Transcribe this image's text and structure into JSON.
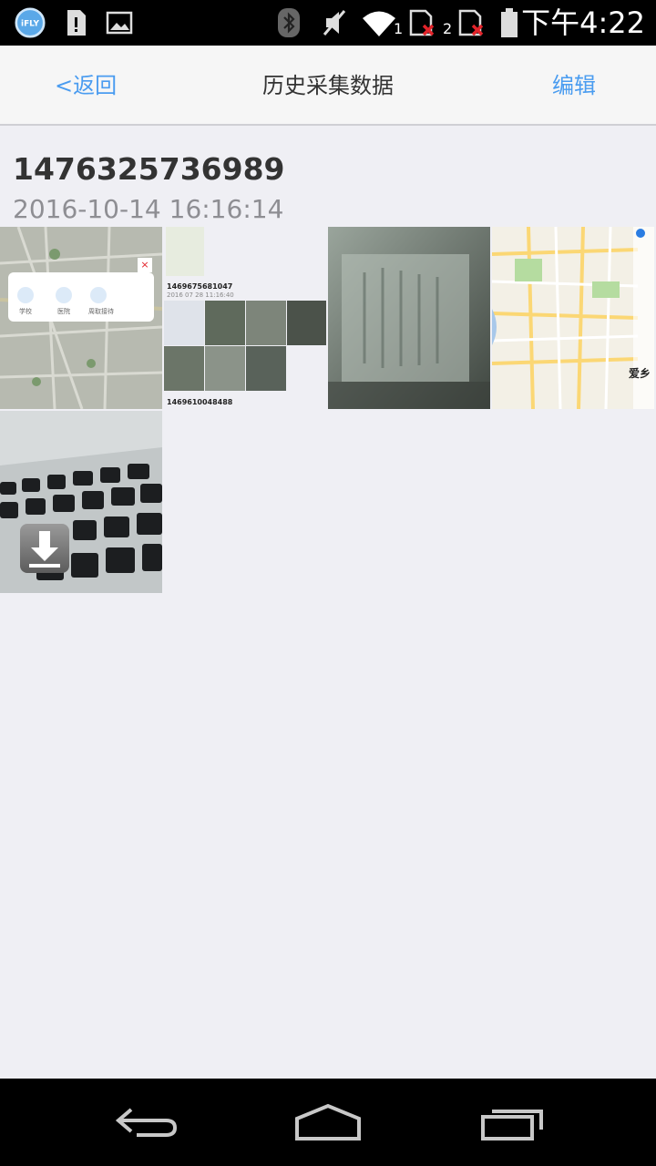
{
  "status_bar": {
    "time": "下午4:22",
    "sim1_label": "1",
    "sim2_label": "2",
    "icons": [
      "ifly-icon",
      "sd-card-icon",
      "image-icon",
      "bluetooth-icon",
      "mute-icon",
      "wifi-icon",
      "sim1-icon",
      "sim2-icon",
      "battery-icon"
    ],
    "app_badge": "iFLY"
  },
  "nav": {
    "back_label": "<返回",
    "title": "历史采集数据",
    "edit_label": "编辑"
  },
  "record": {
    "id": "1476325736989",
    "datetime": "2016-10-14  16:16:14"
  },
  "thumbs": {
    "map_popup_labels": [
      "学校",
      "医院",
      "周取接待"
    ],
    "collage_id_1": "1469675681047",
    "collage_date_1": "2016 07 28  11:16:40",
    "collage_id_2": "1469610048488",
    "map_corner_text": "爱乡"
  },
  "colors": {
    "accent": "#4a9cf0",
    "background": "#efeff4",
    "navbar": "#f6f6f6"
  }
}
